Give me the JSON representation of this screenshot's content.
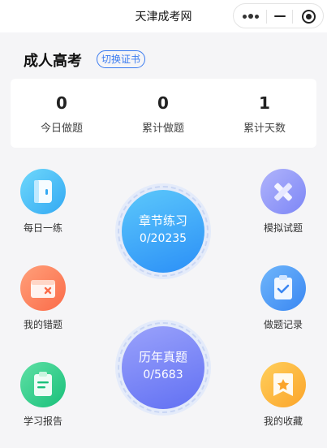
{
  "nav": {
    "title": "天津成考网"
  },
  "header": {
    "title": "成人高考",
    "switch_label": "切换证书"
  },
  "stats": [
    {
      "value": "0",
      "label": "今日做题"
    },
    {
      "value": "0",
      "label": "累计做题"
    },
    {
      "value": "1",
      "label": "累计天数"
    }
  ],
  "tiles": {
    "daily": {
      "label": "每日一练",
      "icon": "notebook-icon"
    },
    "mock": {
      "label": "模拟试题",
      "icon": "pencil-ruler-icon"
    },
    "wrong": {
      "label": "我的错题",
      "icon": "wallet-error-icon"
    },
    "record": {
      "label": "做题记录",
      "icon": "clipboard-check-icon"
    },
    "report": {
      "label": "学习报告",
      "icon": "clipboard-report-icon"
    },
    "favorite": {
      "label": "我的收藏",
      "icon": "bookmark-star-icon"
    }
  },
  "chapter": {
    "title": "章节练习",
    "progress": "0/20235"
  },
  "past": {
    "title": "历年真题",
    "progress": "0/5683"
  },
  "colors": {
    "accent": "#3a7bf0",
    "chapter": "#2b8ff7",
    "past": "#6f7cf6"
  }
}
